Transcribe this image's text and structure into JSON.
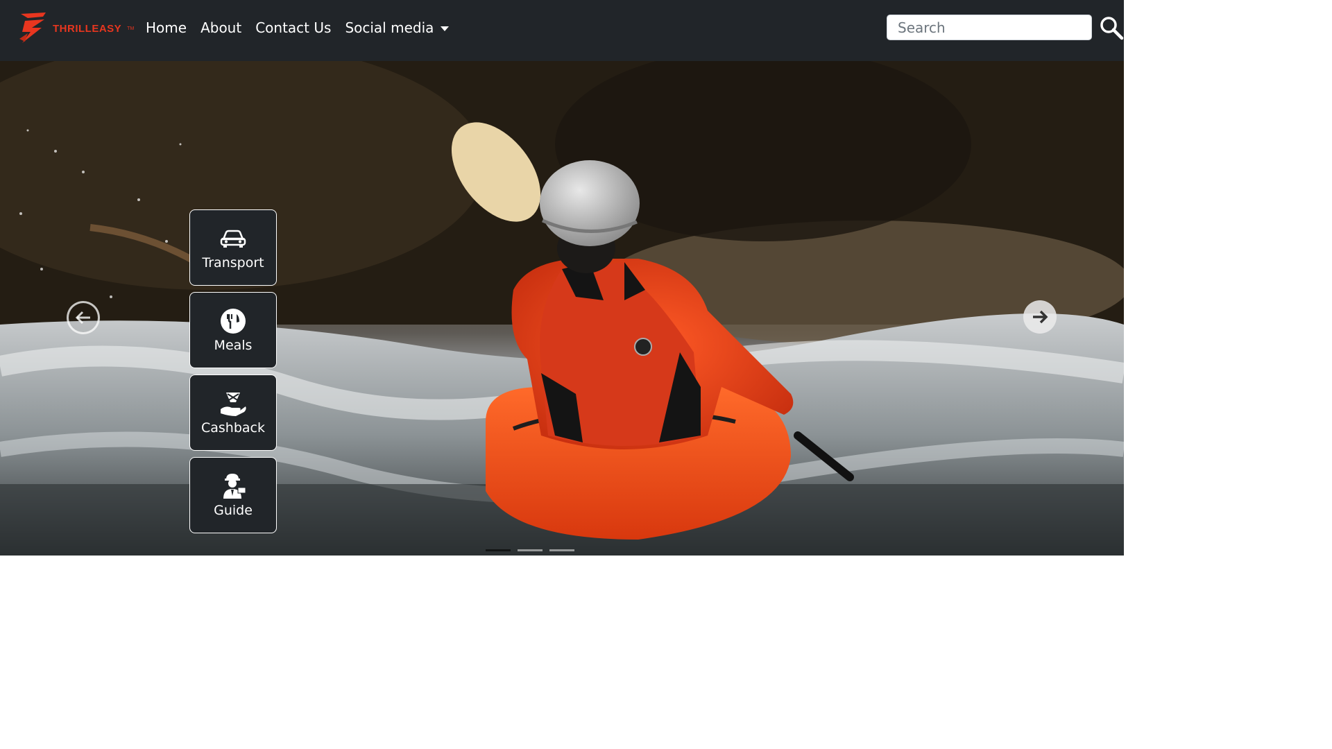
{
  "brand": {
    "name": "THRILLEASY",
    "trademark": "TM",
    "accent_color": "#e8361f"
  },
  "nav": {
    "links": [
      {
        "label": "Home"
      },
      {
        "label": "About"
      },
      {
        "label": "Contact Us"
      }
    ],
    "dropdown_label": "Social media",
    "background_color": "#212529"
  },
  "search": {
    "placeholder": "Search",
    "value": "",
    "button_icon": "magnifier-icon"
  },
  "carousel": {
    "prev_icon": "arrow-left-circle-icon",
    "next_icon": "arrow-right-circle-icon",
    "slide_count": 3,
    "active_slide": 1
  },
  "features": [
    {
      "label": "Transport",
      "icon": "car-icon"
    },
    {
      "label": "Meals",
      "icon": "fork-knife-icon"
    },
    {
      "label": "Cashback",
      "icon": "cashback-hand-icon"
    },
    {
      "label": "Guide",
      "icon": "tour-guide-icon"
    }
  ]
}
